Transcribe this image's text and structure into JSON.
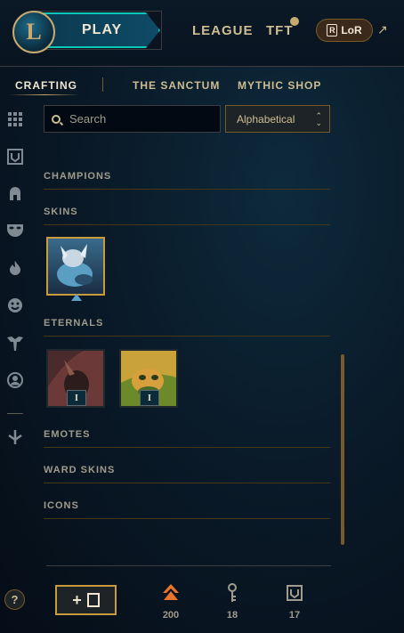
{
  "topbar": {
    "play_label": "PLAY",
    "league_label": "LEAGUE",
    "tft_label": "TFT",
    "lor_label": "LoR",
    "logo_letter": "L"
  },
  "subnav": {
    "tabs": [
      {
        "label": "CRAFTING",
        "active": true
      },
      {
        "label": "THE SANCTUM",
        "active": false
      },
      {
        "label": "MYTHIC SHOP",
        "active": false
      }
    ]
  },
  "sidebar": {
    "icons": [
      "grid-icon",
      "chest-icon",
      "helmet-icon",
      "mask-icon",
      "flame-icon",
      "emote-icon",
      "ward-icon",
      "profile-icon",
      "dropdown-icon"
    ]
  },
  "toolbar": {
    "search_placeholder": "Search",
    "sort_value": "Alphabetical"
  },
  "sections": {
    "champions": "CHAMPIONS",
    "skins": "SKINS",
    "eternals": "ETERNALS",
    "emotes": "EMOTES",
    "ward_skins": "WARD SKINS",
    "icons": "ICONS"
  },
  "eternals": {
    "items": [
      {
        "badge": "I"
      },
      {
        "badge": "I"
      }
    ]
  },
  "footer": {
    "help_label": "?",
    "add_label": "+",
    "currencies": [
      {
        "icon": "orange-essence-icon",
        "value": "200",
        "color": "#e8732a"
      },
      {
        "icon": "key-icon",
        "value": "18",
        "color": "#a09b8c"
      },
      {
        "icon": "chest-icon",
        "value": "17",
        "color": "#a09b8c"
      }
    ]
  },
  "colors": {
    "gold": "#c89b3c",
    "accent_teal": "#0ac8b9",
    "text": "#a09b8c"
  }
}
